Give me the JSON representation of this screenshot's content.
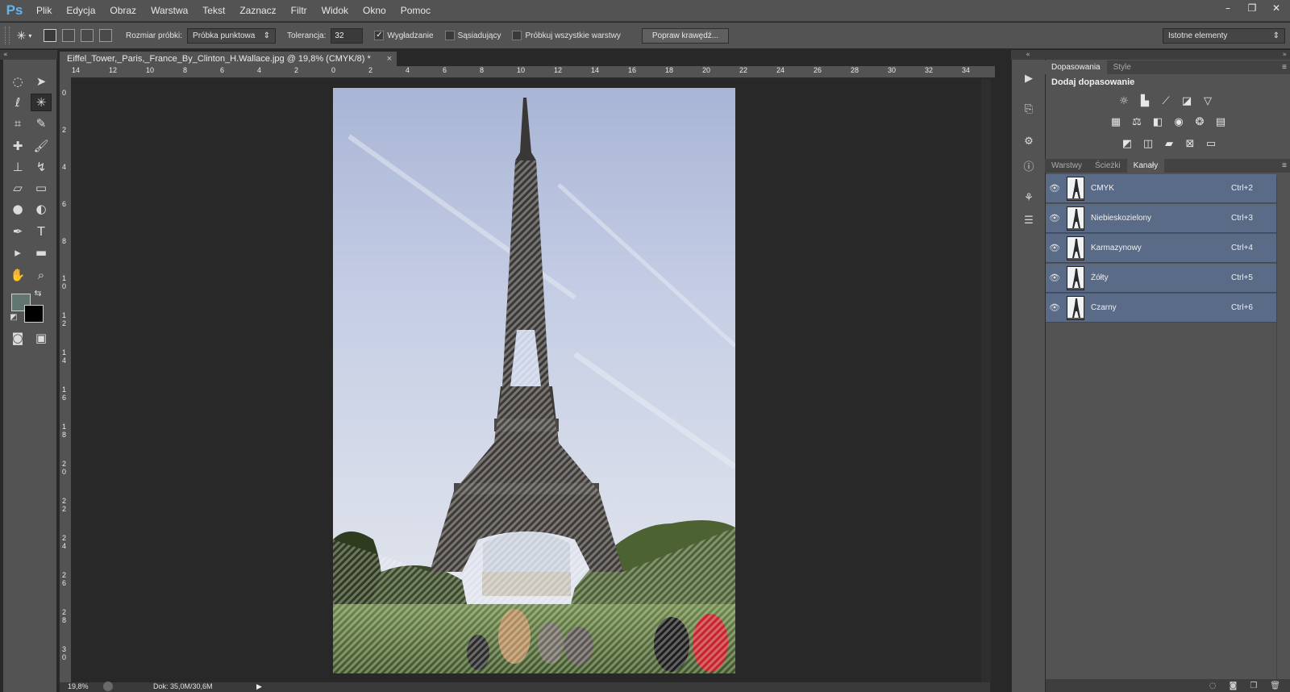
{
  "app": {
    "logo": "Ps"
  },
  "menu": [
    "Plik",
    "Edycja",
    "Obraz",
    "Warstwa",
    "Tekst",
    "Zaznacz",
    "Filtr",
    "Widok",
    "Okno",
    "Pomoc"
  ],
  "window_controls": {
    "minimize": "–",
    "restore": "❐",
    "close": "✕"
  },
  "options": {
    "sample_size_label": "Rozmiar próbki:",
    "sample_size_value": "Próbka punktowa",
    "tolerance_label": "Tolerancja:",
    "tolerance_value": "32",
    "antialias_label": "Wygładzanie",
    "antialias_checked": true,
    "contiguous_label": "Sąsiadujący",
    "contiguous_checked": false,
    "sample_all_label": "Próbkuj wszystkie warstwy",
    "sample_all_checked": false,
    "refine_button": "Popraw krawędź...",
    "workspace_value": "Istotne elementy"
  },
  "document": {
    "tab_title": "Eiffel_Tower,_Paris,_France_By_Clinton_H.Wallace.jpg @ 19,8% (CMYK/8) *",
    "close_glyph": "×",
    "ruler_h": [
      "14",
      "12",
      "10",
      "8",
      "6",
      "4",
      "2",
      "0",
      "2",
      "4",
      "6",
      "8",
      "10",
      "12",
      "14",
      "16",
      "18",
      "20",
      "22",
      "24",
      "26",
      "28",
      "30",
      "32",
      "34"
    ],
    "ruler_v": [
      "0",
      "2",
      "4",
      "6",
      "8",
      "1 0",
      "1 2",
      "1 4",
      "1 6",
      "1 8",
      "2 0",
      "2 2",
      "2 4",
      "2 6",
      "2 8",
      "3 0"
    ]
  },
  "status": {
    "zoom": "19,8%",
    "doc_info": "Dok: 35,0M/30,6M"
  },
  "colors": {
    "foreground": "#5e7570",
    "background": "#000000",
    "channel_selected": "#5a6b87"
  },
  "panels": {
    "top_tabs": [
      "Dopasowania",
      "Style"
    ],
    "adjust_title": "Dodaj dopasowanie",
    "bottom_tabs": [
      "Warstwy",
      "Ścieżki",
      "Kanały"
    ],
    "channels": [
      {
        "name": "CMYK",
        "shortcut": "Ctrl+2"
      },
      {
        "name": "Niebieskozielony",
        "shortcut": "Ctrl+3"
      },
      {
        "name": "Karmazynowy",
        "shortcut": "Ctrl+4"
      },
      {
        "name": "Żółty",
        "shortcut": "Ctrl+5"
      },
      {
        "name": "Czarny",
        "shortcut": "Ctrl+6"
      }
    ]
  }
}
